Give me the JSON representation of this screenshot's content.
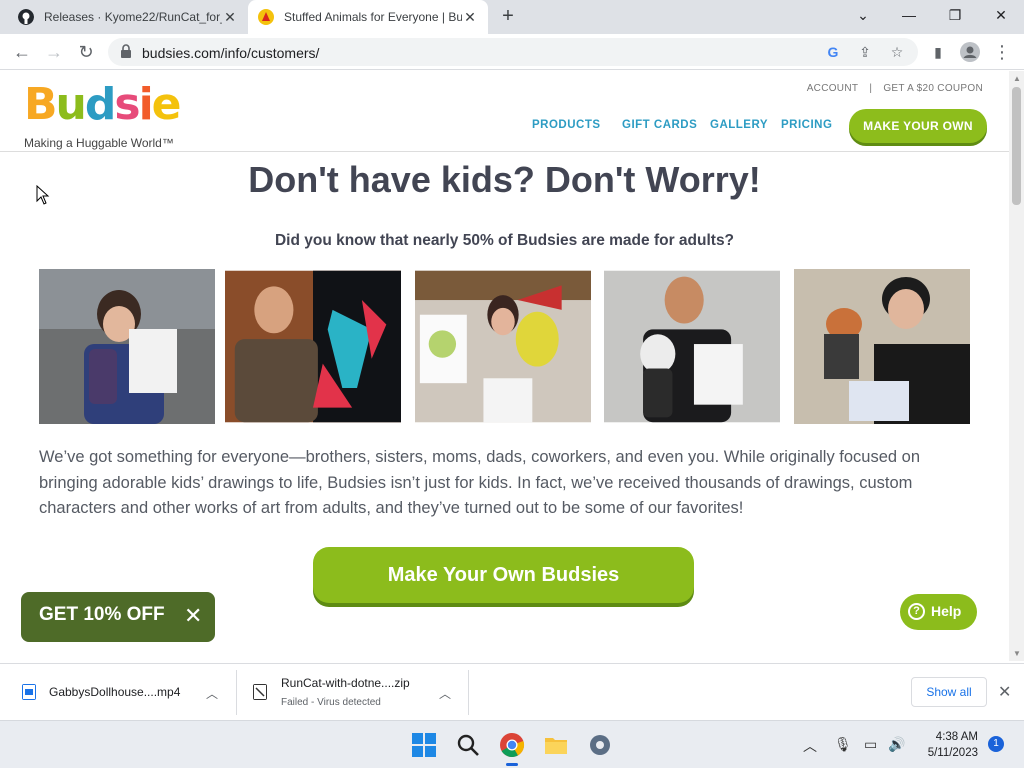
{
  "browser": {
    "tabs": [
      {
        "title": "Releases · Kyome22/RunCat_for_",
        "favicon": "github-icon"
      },
      {
        "title": "Stuffed Animals for Everyone | Bu",
        "favicon": "budsies-icon",
        "active": true
      }
    ],
    "url": "budsies.com/info/customers/",
    "window_controls": {
      "minimize": "—",
      "restore": "❐",
      "close": "✕",
      "tab_search": "⌄"
    }
  },
  "site": {
    "logo_text": "Budsies",
    "tagline": "Making a Huggable World™",
    "top_links": [
      "ACCOUNT",
      "|",
      "GET A $20 COUPON"
    ],
    "nav": [
      "PRODUCTS",
      "GIFT CARDS",
      "GALLERY",
      "PRICING"
    ],
    "nav_cta": "MAKE YOUR OWN"
  },
  "main": {
    "headline": "Don't have kids? Don't Worry!",
    "subhead": "Did you know that nearly 50% of Budsies are made for adults?",
    "body": "We’ve got something for everyone—brothers, sisters, moms, dads, coworkers, and even you. While originally focused on bringing adorable kids’ drawings to life, Budsies isn’t just for kids. In fact, we’ve received thousands of drawings, custom characters and other works of art from adults, and they’ve turned out to be some of our favorites!",
    "cta": "Make Your Own Budsies"
  },
  "promo": {
    "label": "GET 10% OFF",
    "close": "✕"
  },
  "help": {
    "label": "Help",
    "icon": "?"
  },
  "downloads": {
    "items": [
      {
        "name": "GabbysDollhouse....mp4",
        "status": ""
      },
      {
        "name": "RunCat-with-dotne....zip",
        "status": "Failed - Virus detected"
      }
    ],
    "show_all": "Show all"
  },
  "taskbar": {
    "time": "4:38 AM",
    "date": "5/11/2023",
    "notification_count": "1"
  },
  "colors": {
    "accent_green": "#8dbd1c",
    "nav_blue": "#2d9cc3",
    "heading": "#424553"
  }
}
